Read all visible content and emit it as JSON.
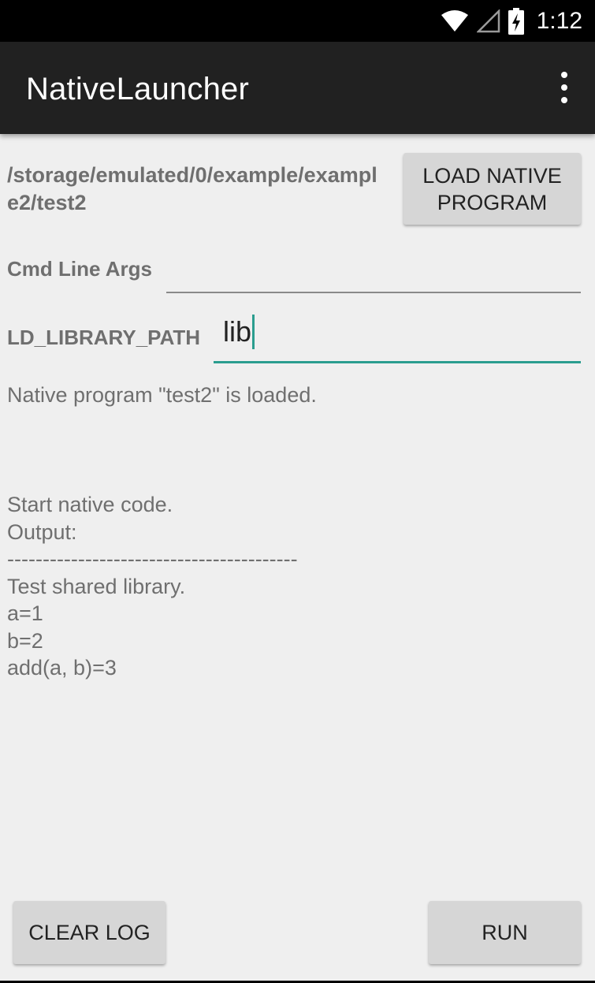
{
  "status_bar": {
    "time": "1:12",
    "icons": [
      "wifi-icon",
      "cell-signal-icon",
      "battery-charging-icon"
    ]
  },
  "app_bar": {
    "title": "NativeLauncher",
    "overflow_icon": "overflow-menu-icon"
  },
  "program": {
    "path": "/storage/emulated/0/example/example2/test2",
    "load_button_label": "LOAD NATIVE PROGRAM"
  },
  "form": {
    "args_label": "Cmd Line Args",
    "args_value": "",
    "ld_label": "LD_LIBRARY_PATH",
    "ld_value": "lib"
  },
  "status_message": "Native program \"test2\" is loaded.",
  "log": {
    "lines": [
      "Start native code.",
      "Output:",
      "-----------------------------------------",
      "Test shared library.",
      "a=1",
      "b=2",
      "add(a, b)=3"
    ]
  },
  "actions": {
    "clear_label": "CLEAR LOG",
    "run_label": "RUN"
  },
  "colors": {
    "accent": "#2a9d8f",
    "app_bar": "#212121",
    "background": "#efefef"
  }
}
